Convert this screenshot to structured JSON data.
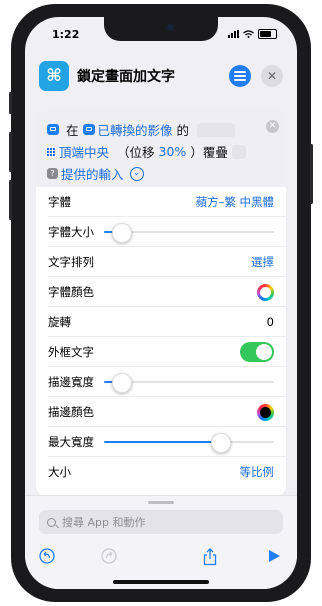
{
  "status_bar": {
    "time": "1:22"
  },
  "header": {
    "title": "鎖定畫面加文字"
  },
  "action": {
    "line1": {
      "prefix": "在",
      "variable": "已轉換的影像",
      "suffix": "的"
    },
    "line2": {
      "position": "頂端中央",
      "offset_open": "（位移",
      "offset_value": "30%",
      "offset_close": "）覆疊"
    },
    "line3": {
      "input": "提供的輸入"
    }
  },
  "settings": {
    "font": {
      "label": "字體",
      "value": "蘋方–繁 中黑體"
    },
    "font_size": {
      "label": "字體大小",
      "level": 0.1
    },
    "alignment": {
      "label": "文字排列",
      "value": "選擇"
    },
    "font_color": {
      "label": "字體顏色"
    },
    "rotation": {
      "label": "旋轉",
      "value": "0"
    },
    "outline": {
      "label": "外框文字",
      "enabled": true
    },
    "stroke_width": {
      "label": "描邊寬度",
      "level": 0.1
    },
    "stroke_color": {
      "label": "描邊顏色"
    },
    "max_width": {
      "label": "最大寬度",
      "level": 0.68
    },
    "size": {
      "label": "大小",
      "value": "等比例"
    }
  },
  "search": {
    "placeholder": "搜尋 App 和動作"
  },
  "colors": {
    "accent": "#1f7ef4",
    "toggle_on": "#34c759",
    "app_icon": "#22a3e3"
  }
}
